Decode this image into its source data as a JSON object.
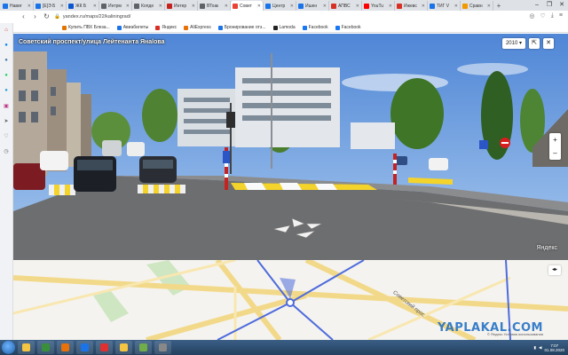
{
  "tabs": [
    {
      "label": "Навиг",
      "color": "#1a73e8"
    },
    {
      "label": "[Е]Э Б",
      "color": "#1a73e8"
    },
    {
      "label": "ЖК Б",
      "color": "#0b57d0"
    },
    {
      "label": "Интрм",
      "color": "#5f6368"
    },
    {
      "label": "Копде",
      "color": "#5f6368"
    },
    {
      "label": "Интер",
      "color": "#c5221f"
    },
    {
      "label": "ВТоак",
      "color": "#5f6368"
    },
    {
      "label": "Совет",
      "color": "#ea4335",
      "active": true
    },
    {
      "label": "Центр",
      "color": "#1a73e8"
    },
    {
      "label": "Ишен",
      "color": "#1a73e8"
    },
    {
      "label": "АПВС",
      "color": "#d93025"
    },
    {
      "label": "YouTu",
      "color": "#ff0000"
    },
    {
      "label": "Ижевс",
      "color": "#d93025"
    },
    {
      "label": "ТИГ V",
      "color": "#1a73e8"
    },
    {
      "label": "Сравн",
      "color": "#f29900"
    }
  ],
  "address": {
    "url": "yandex.ru/maps/22/kaliningrad/"
  },
  "bookmarks": [
    {
      "label": "Купить ПВХ Блеза...",
      "color": "#e37400"
    },
    {
      "label": "Авиабилеты",
      "color": "#1a73e8"
    },
    {
      "label": "Яндекс",
      "color": "#d93025"
    },
    {
      "label": "AliExpress",
      "color": "#e8710a"
    },
    {
      "label": "Бронирование отэ...",
      "color": "#1a73e8"
    },
    {
      "label": "Lamoda",
      "color": "#222222"
    },
    {
      "label": "Facebook",
      "color": "#1877f2"
    },
    {
      "label": "Facebook",
      "color": "#1877f2"
    }
  ],
  "streetview": {
    "title": "Советский проспект/улица Лейтенанта Янаlова",
    "year": "2010",
    "logo": "Яндекс"
  },
  "map": {
    "street_label": "Советский прос",
    "collapse_label": "◂▸",
    "copyright": "© Яндекс Условия использования"
  },
  "watermark": "YAPLAKAL.COM",
  "taskbar": {
    "time": "7:07",
    "date": "01.08.2020",
    "apps": [
      {
        "color": "#f4c542"
      },
      {
        "color": "#3a8f3a"
      },
      {
        "color": "#e8710a"
      },
      {
        "color": "#1a73e8"
      },
      {
        "color": "#e03030"
      },
      {
        "color": "#f4c542"
      },
      {
        "color": "#6fae4a"
      },
      {
        "color": "#888888"
      }
    ]
  }
}
